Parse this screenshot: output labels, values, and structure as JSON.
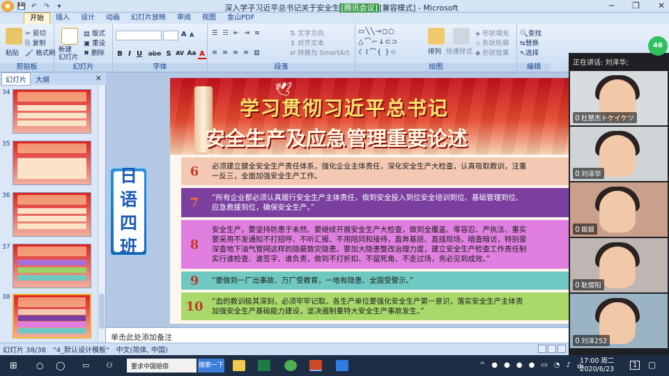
{
  "window": {
    "title": "深入学子习近平总书记关于安全生产... [腾讯会议] [兼容模式] - Microsoft PowerPoint",
    "title_left": "深入学子习近平总书记关于安全生",
    "title_tag": "[腾讯会议]",
    "title_right": "[兼容模式] - Microsoft PowerPoint",
    "minimize": "─",
    "restore": "❐",
    "close": "✕"
  },
  "ribbon_tabs": [
    "开始",
    "插入",
    "设计",
    "动画",
    "幻灯片放映",
    "审阅",
    "视图",
    "金山PDF"
  ],
  "ribbon": {
    "clipboard": {
      "paste": "粘贴",
      "cut": "剪切",
      "copy": "复制",
      "format_painter": "格式刷",
      "label": "剪贴板"
    },
    "slides": {
      "new_slide": "新建\n幻灯片",
      "layout": "版式",
      "reset": "重设",
      "delete": "删除",
      "label": "幻灯片"
    },
    "font": {
      "label": "字体",
      "bold": "B",
      "italic": "I",
      "underline": "U",
      "strike": "abe",
      "shadow": "S",
      "spacing": "AV",
      "case": "Aa",
      "color": "A",
      "grow": "A",
      "shrink": "A"
    },
    "paragraph": {
      "label": "段落",
      "text_direction": "文字方向",
      "align_text": "对齐文本",
      "smartart": "转换为 SmartArt"
    },
    "drawing": {
      "label": "绘图",
      "arrange": "排列",
      "quick_styles": "快速样式",
      "shape_fill": "形状填充",
      "shape_outline": "形状轮廓",
      "shape_effects": "形状效果"
    },
    "editing": {
      "label": "编辑",
      "find": "查找",
      "replace": "替换",
      "select": "选择"
    }
  },
  "left_pane": {
    "tabs": [
      "幻灯片",
      "大纲"
    ],
    "close": "✕",
    "slide_numbers": [
      "34",
      "35",
      "36",
      "37",
      "38"
    ],
    "selected": "38"
  },
  "nameplate": {
    "text": [
      "日",
      "语",
      "四",
      "班"
    ]
  },
  "slide": {
    "title_line1": "学习贯彻习近平总书记",
    "title_line2": "安全生产及应急管理重要论述",
    "rows": [
      {
        "num": "6",
        "text": "必须建立健全安全生产责任体系，强化企业主体责任，深化安全生产大检查，认真吸取教训，注重\n一反三，全面加强安全生产工作。",
        "bg": "#f3c9b4",
        "numcolor": "#c0392b"
      },
      {
        "num": "7",
        "text": "“所有企业都必须认真履行安全生产主体责任，做到安全投入到位安全培训到位、基础管理到位、\n应急救援到位，确保安全生产。”",
        "bg": "#7b3fa0",
        "numcolor": "#ff6a2b"
      },
      {
        "num": "8",
        "text": "安全生产，要坚持防患于未然。要继续开展安全生产大检查，做到全覆盖、零容忍、严执法、重实\n要采用不发通知不打招呼、不听汇报、不用陪同和接待，直奔基层、直插现场，暗查暗访，特别是\n深查地下油气管网这样的隐蔽致灾隐患。要加大隐患整改治理力度，建立安全生产检查工作责任制\n实行谁检查、谁签字、谁负责，做到不打折扣、不留死角、不走过场，务必见到成效。”",
        "bg": "#e07fe0",
        "numcolor": "#c0392b"
      },
      {
        "num": "9",
        "text": "“要做到一厂出事故、万厂受教育，一地有隐患、全国受警示。”",
        "bg": "#6fc9c2",
        "numcolor": "#c0392b"
      },
      {
        "num": "10",
        "text": "“血的教训极其深刻，必须牢牢记取。各生产单位要强化安全生产第一意识，落实安全生产主体责\n加强安全生产基础能力建设，坚决遏制重特大安全生产事故发生。”",
        "bg": "#a9d96a",
        "numcolor": "#c0392b"
      }
    ]
  },
  "notes": {
    "placeholder": "单击此处添加备注"
  },
  "status": {
    "slide": "幻灯片 38/38",
    "theme": "\"4_默认设计模板\"",
    "lang": "中文(简体, 中国)"
  },
  "meeting": {
    "speaking": "正在讲话: 刘泽华;",
    "badge": "46",
    "participants": [
      {
        "name": "杜慧杰トケイケツ"
      },
      {
        "name": "刘泽华"
      },
      {
        "name": "姬姬"
      },
      {
        "name": "耿熠阳"
      },
      {
        "name": "刘泽252"
      }
    ]
  },
  "taskbar": {
    "search_text": "要求中国赔偿",
    "search_button": "搜索一下",
    "time": "17:00 周二",
    "date": "2020/6/23",
    "lang": "中",
    "notify_count": "1"
  },
  "colors": {
    "ribbon_bg": "#dbe7f6",
    "slide_header": "#c3121e",
    "taskbar": "#1d2d44"
  }
}
